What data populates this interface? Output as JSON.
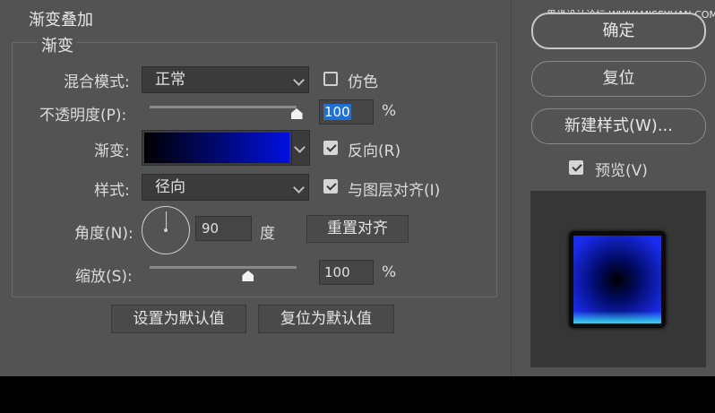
{
  "watermark": "思缘设计论坛 WWW.MISSYUAN.COM",
  "panel": {
    "title": "渐变叠加",
    "group_title": "渐变"
  },
  "blend_mode": {
    "label": "混合模式:",
    "value": "正常"
  },
  "dither": {
    "label": "仿色",
    "checked": false
  },
  "opacity": {
    "label": "不透明度(P):",
    "value": "100",
    "unit": "%",
    "slider_fraction": 1.0
  },
  "gradient": {
    "label": "渐变:",
    "colors": [
      "#000000",
      "#0010e0"
    ],
    "reverse": {
      "label": "反向(R)",
      "checked": true
    }
  },
  "style": {
    "label": "样式:",
    "value": "径向",
    "align_with_layer": {
      "label": "与图层对齐(I)",
      "checked": true
    }
  },
  "angle": {
    "label": "角度(N):",
    "value": "90",
    "unit": "度",
    "degrees": 90
  },
  "reset_alignment": {
    "label": "重置对齐"
  },
  "scale": {
    "label": "缩放(S):",
    "value": "100",
    "unit": "%",
    "slider_fraction": 0.67
  },
  "footer_buttons": {
    "set_default": "设置为默认值",
    "reset_default": "复位为默认值"
  },
  "side_buttons": {
    "ok": "确定",
    "reset": "复位",
    "new_style": "新建样式(W)..."
  },
  "preview": {
    "label": "预览(V)",
    "checked": true
  },
  "colors": {
    "dialog_bg": "#535353",
    "field_bg": "#3b3b3b",
    "preview_bg": "#363636",
    "swatch_center": "#000000",
    "swatch_edge": "#1a2cf0",
    "swatch_bottom_glow": "#38d6e8"
  }
}
